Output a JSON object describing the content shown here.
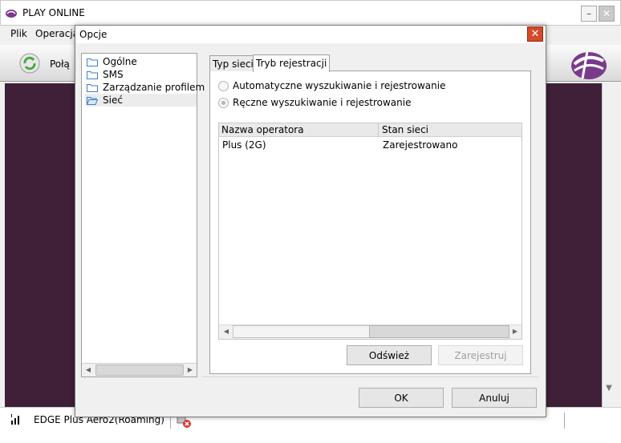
{
  "main_window": {
    "title": "PLAY ONLINE",
    "menu": [
      "Plik",
      "Operacja"
    ],
    "toolbar": {
      "connect_label": "Połą"
    },
    "status": {
      "text": "EDGE  Plus Aero2(Roaming)"
    }
  },
  "dialog": {
    "title": "Opcje",
    "tree": [
      {
        "label": "Ogólne",
        "selected": false
      },
      {
        "label": "SMS",
        "selected": false
      },
      {
        "label": "Zarządzanie profilem",
        "selected": false
      },
      {
        "label": "Sieć",
        "selected": true
      }
    ],
    "tabs": [
      {
        "label": "Typ sieci",
        "active": false
      },
      {
        "label": "Tryb rejestracji",
        "active": true
      }
    ],
    "radios": [
      {
        "label": "Automatyczne wyszukiwanie i rejestrowanie",
        "checked": false
      },
      {
        "label": "Ręczne wyszukiwanie i rejestrowanie",
        "checked": true
      }
    ],
    "table": {
      "columns": [
        "Nazwa operatora",
        "Stan sieci"
      ],
      "rows": [
        [
          "Plus (2G)",
          "Zarejestrowano"
        ]
      ]
    },
    "buttons": {
      "refresh": "Odśwież",
      "register": "Zarejestruj",
      "ok": "OK",
      "cancel": "Anuluj"
    }
  },
  "colors": {
    "content_bg": "#3f2038",
    "dialog_close": "#d44a2a",
    "brand": "#7a3a8c"
  }
}
